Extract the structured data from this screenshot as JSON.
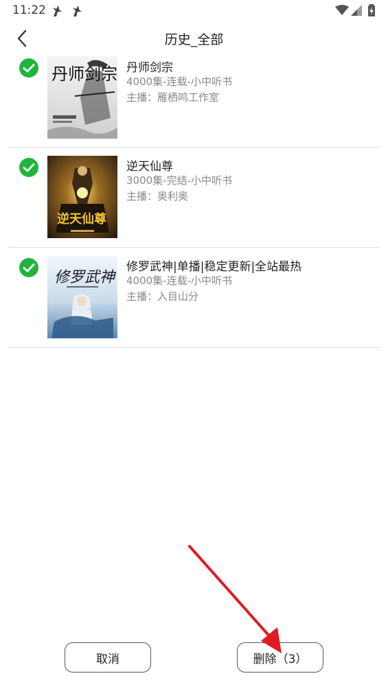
{
  "status_bar": {
    "time": "11:22"
  },
  "header": {
    "title": "历史_全部"
  },
  "items": [
    {
      "title": "丹师剑宗",
      "meta": "4000集-连载-小中听书",
      "host": "主播：雁栖鸣工作室",
      "cover_title": "丹师剑宗",
      "selected": true
    },
    {
      "title": "逆天仙尊",
      "meta": "3000集-完结-小中听书",
      "host": "主播：奥利奥",
      "cover_title": "逆天仙尊",
      "selected": true
    },
    {
      "title": "修罗武神|单播|稳定更新|全站最热",
      "meta": "4000集-连载-小中听书",
      "host": "主播：入目山分",
      "cover_title": "修罗武神",
      "selected": true
    }
  ],
  "footer": {
    "cancel_label": "取消",
    "delete_label": "删除（3）"
  },
  "colors": {
    "check_green": "#1fb53a",
    "arrow_red": "#e01b24"
  }
}
